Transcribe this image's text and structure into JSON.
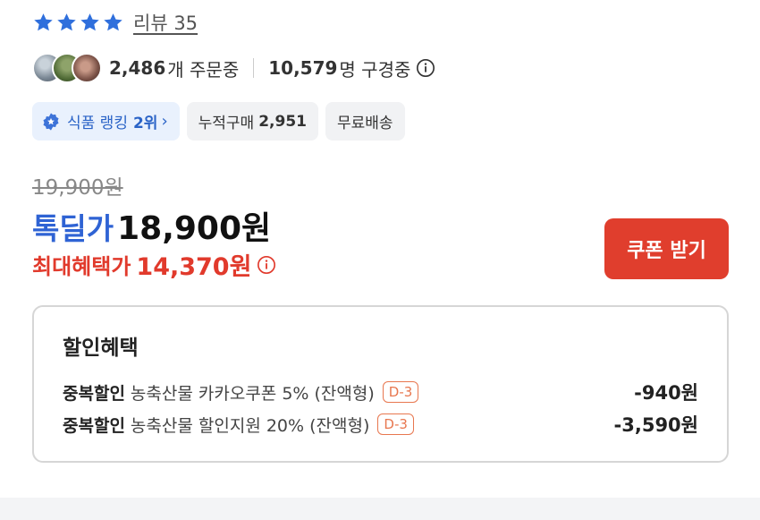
{
  "rating": {
    "stars": 4,
    "review_label": "리뷰 35"
  },
  "stats": {
    "order_count": "2,486",
    "order_suffix": "개 주문중",
    "subscriber_count": "10,579",
    "subscriber_suffix": "명 구경중"
  },
  "chips": {
    "ranking_text": "식품 랭킹",
    "ranking_value": "2위",
    "cumulative_label": "누적구매",
    "cumulative_value": "2,951",
    "shipping_label": "무료배송"
  },
  "price": {
    "original": "19,900원",
    "deal_label": "톡딜가",
    "deal_price": "18,900원",
    "max_label": "최대혜택가",
    "max_price": "14,370원"
  },
  "coupon_button": "쿠폰 받기",
  "benefits": {
    "title": "할인혜택",
    "items": [
      {
        "type": "중복할인",
        "desc": "농축산물 카카오쿠폰 5% (잔액형)",
        "tag": "D-3",
        "amount": "-940원"
      },
      {
        "type": "중복할인",
        "desc": "농축산물 할인지원 20% (잔액형)",
        "tag": "D-3",
        "amount": "-3,590원"
      }
    ]
  },
  "colors": {
    "star": "#2f6fdc",
    "deal_blue": "#2f63d4",
    "accent_red": "#e13a2c",
    "button_red": "#e03e2d",
    "tag_orange": "#e8774f"
  },
  "icons": {
    "star": "star-icon",
    "info": "info-icon",
    "ranking": "ranking-badge-icon",
    "chevron": "chevron-right-icon"
  }
}
